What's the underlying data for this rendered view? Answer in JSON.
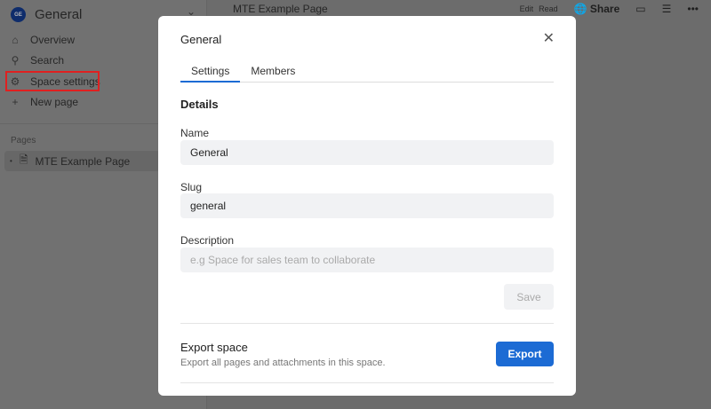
{
  "sidebar": {
    "workspace_initials": "GE",
    "workspace_name": "General",
    "nav": [
      "Overview",
      "Search",
      "Space settings",
      "New page"
    ],
    "pages_label": "Pages",
    "pages": [
      "MTE Example Page"
    ]
  },
  "topbar": {
    "page_title": "MTE Example Page",
    "edit": "Edit",
    "read": "Read",
    "share": "Share"
  },
  "modal": {
    "title": "General",
    "tabs": [
      "Settings",
      "Members"
    ],
    "details_heading": "Details",
    "name_label": "Name",
    "name_value": "General",
    "slug_label": "Slug",
    "slug_value": "general",
    "description_label": "Description",
    "description_placeholder": "e.g Space for sales team to collaborate",
    "save": "Save",
    "export_title": "Export space",
    "export_desc": "Export all pages and attachments in this space.",
    "export_button": "Export"
  }
}
